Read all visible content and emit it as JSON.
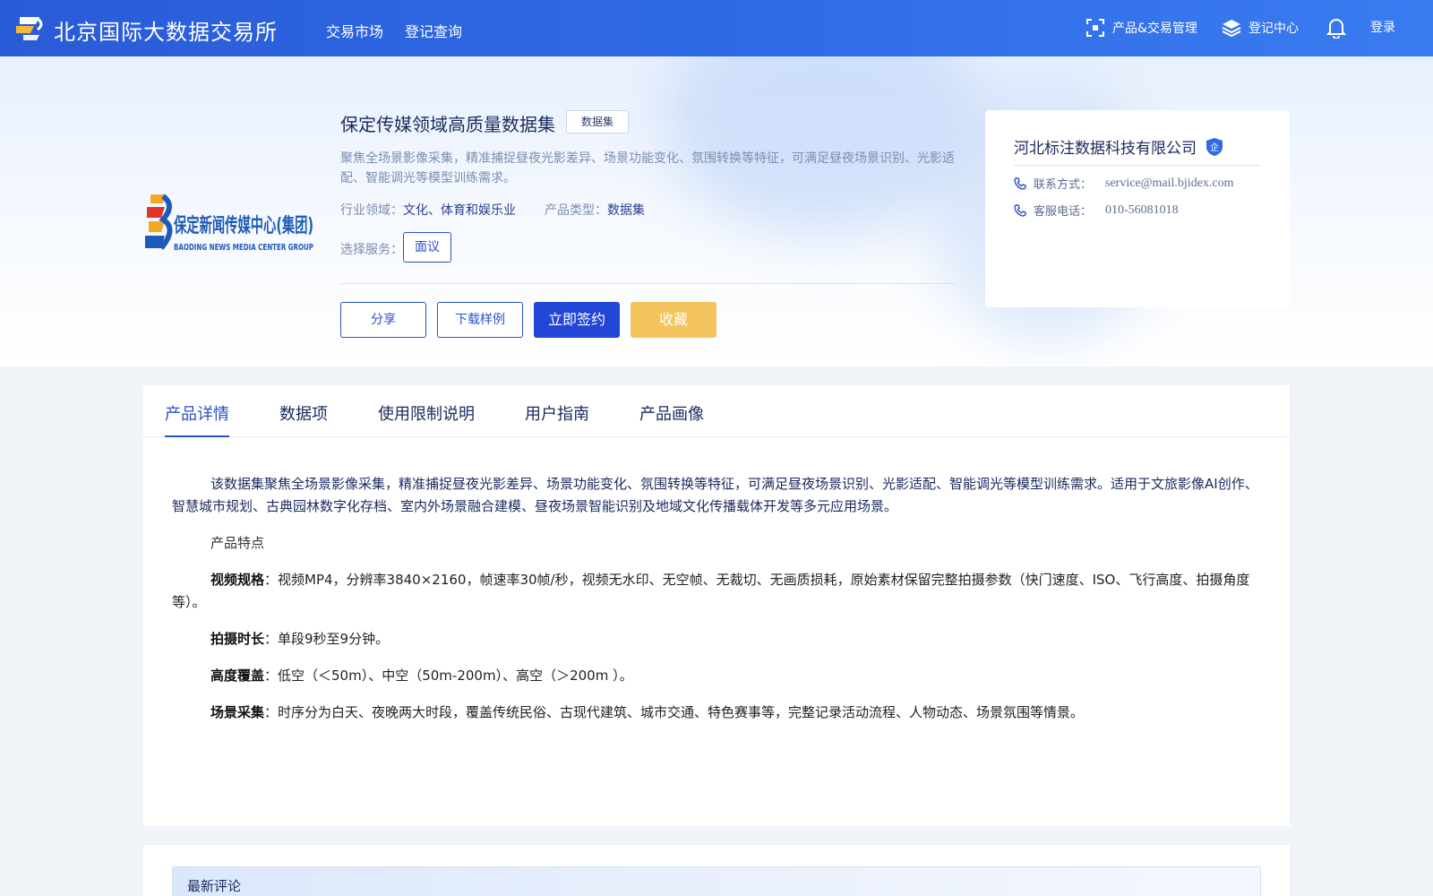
{
  "header": {
    "brand": "北京国际大数据交易所",
    "nav": [
      "交易市场",
      "登记查询"
    ],
    "right": {
      "product_mgmt": "产品&交易管理",
      "register_center": "登记中心",
      "login": "登录"
    }
  },
  "product": {
    "title": "保定传媒领域高质量数据集",
    "tag": "数据集",
    "description": "聚焦全场景影像采集，精准捕捉昼夜光影差异、场景功能变化、氛围转换等特征，可满足昼夜场景识别、光影适配、智能调光等模型训练需求。",
    "industry_label": "行业领域：",
    "industry_value": "文化、体育和娱乐业",
    "type_label": "产品类型：",
    "type_value": "数据集",
    "service_label": "选择服务：",
    "service_option": "面议",
    "logo_text_cn": "保定新闻传媒中心(集团)",
    "logo_text_en": "BAODING NEWS MEDIA CENTER GROUP"
  },
  "actions": {
    "share": "分享",
    "download_sample": "下载样例",
    "sign_now": "立即签约",
    "favorite": "收藏"
  },
  "company": {
    "name": "河北标注数据科技有限公司",
    "badge": "企",
    "contact_label": "联系方式：",
    "contact_value": "service@mail.bjidex.com",
    "phone_label": "客服电话：",
    "phone_value": "010-56081018"
  },
  "tabs": [
    "产品详情",
    "数据项",
    "使用限制说明",
    "用户指南",
    "产品画像"
  ],
  "detail": {
    "intro": "该数据集聚焦全场景影像采集，精准捕捉昼夜光影差异、场景功能变化、氛围转换等特征，可满足昼夜场景识别、光影适配、智能调光等模型训练需求。适用于文旅影像AI创作、智慧城市规划、古典园林数字化存档、室内外场景融合建模、昼夜场景智能识别及地域文化传播载体开发等多元应用场景。",
    "features_heading": "产品特点",
    "features": [
      {
        "label": "视频规格",
        "text": "：视频MP4，分辨率3840×2160，帧速率30帧/秒，视频无水印、无空帧、无裁切、无画质损耗，原始素材保留完整拍摄参数（快门速度、ISO、飞行高度、拍摄角度等）。"
      },
      {
        "label": "拍摄时长",
        "text": "：单段9秒至9分钟。"
      },
      {
        "label": "高度覆盖",
        "text": "：低空（＜50m）、中空（50m-200m）、高空（＞200m ）。"
      },
      {
        "label": "场景采集",
        "text": "：时序分为白天、夜晚两大时段，覆盖传统民俗、古现代建筑、城市交通、特色赛事等，完整记录活动流程、人物动态、场景氛围等情景。"
      }
    ]
  },
  "comments": {
    "title": "最新评论"
  },
  "colors": {
    "primary": "#2246d6",
    "nav_bg": "#2f6ae6",
    "favorite": "#f4c45c",
    "text_dark": "#1a2a5c"
  }
}
